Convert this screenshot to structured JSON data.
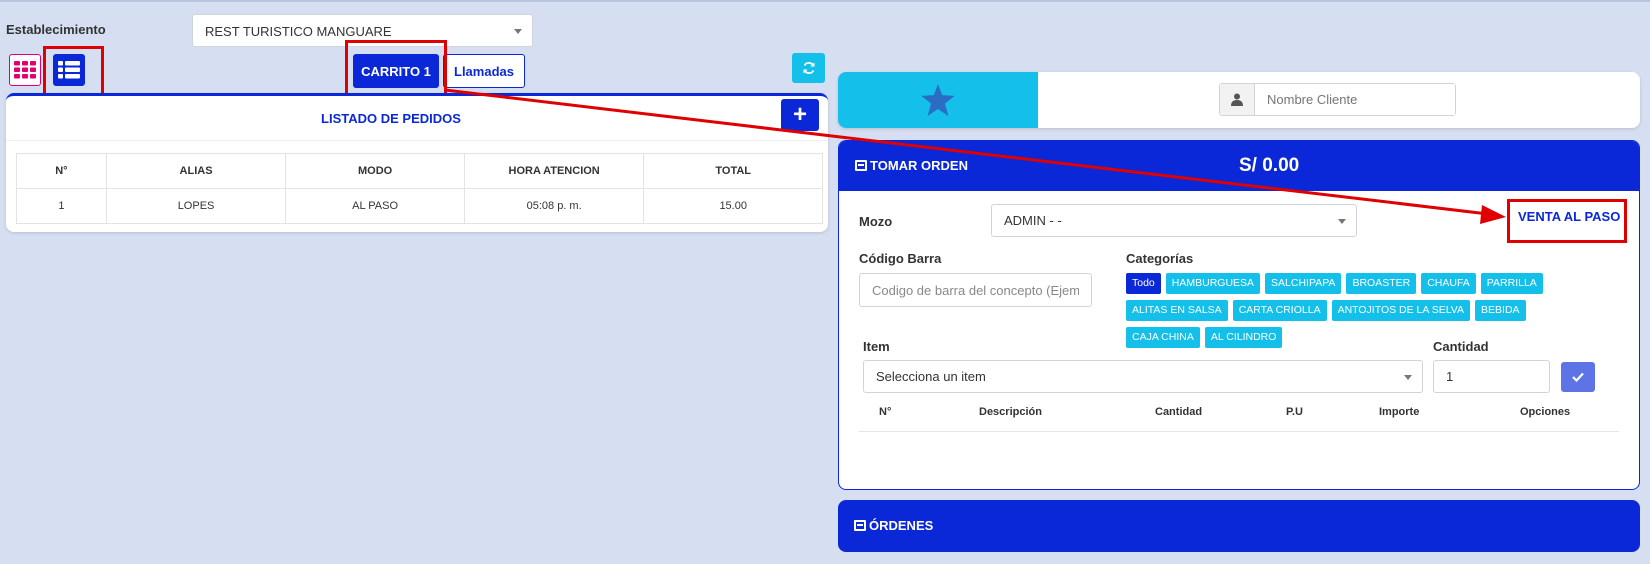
{
  "establecimiento": {
    "label": "Establecimiento",
    "selected": "REST TURISTICO MANGUARE"
  },
  "view_toggle": {
    "grid_icon": "grid-icon",
    "list_icon": "list-icon"
  },
  "tabs": {
    "carrito": "CARRITO 1",
    "llamadas": "Llamadas"
  },
  "refresh_icon": "refresh-icon",
  "orders_list": {
    "title": "LISTADO DE PEDIDOS",
    "add_label": "+",
    "headers": [
      "N°",
      "ALIAS",
      "MODO",
      "HORA ATENCION",
      "TOTAL"
    ],
    "rows": [
      [
        "1",
        "LOPES",
        "AL PASO",
        "05:08 p. m.",
        "15.00"
      ]
    ]
  },
  "client": {
    "star_icon": "star-icon",
    "user_icon": "user-icon",
    "placeholder": "Nombre Cliente"
  },
  "order": {
    "title": "TOMAR ORDEN",
    "total": "S/ 0.00",
    "mozo_label": "Mozo",
    "mozo_value": "ADMIN - -",
    "venta_al_paso": "VENTA AL PASO",
    "barcode_label": "Código Barra",
    "barcode_placeholder": "Codigo de barra del concepto (Ejem",
    "categories_label": "Categorías",
    "categories": [
      "Todo",
      "HAMBURGUESA",
      "SALCHIPAPA",
      "BROASTER",
      "CHAUFA",
      "PARRILLA",
      "ALITAS EN SALSA",
      "CARTA CRIOLLA",
      "ANTOJITOS DE LA SELVA",
      "BEBIDA",
      "CAJA CHINA",
      "AL CILINDRO"
    ],
    "active_category": "Todo",
    "item_label": "Item",
    "item_placeholder": "Selecciona un item",
    "cantidad_label": "Cantidad",
    "cantidad_value": "1",
    "table_headers": [
      "N°",
      "Descripción",
      "Cantidad",
      "P.U",
      "Importe",
      "Opciones"
    ]
  },
  "ordenes": {
    "title": "ÓRDENES"
  },
  "colors": {
    "primary": "#0a28d8",
    "info": "#14c0ea",
    "background": "#d6dff2",
    "highlight": "#e00000",
    "grid_accent": "#e0006e"
  }
}
